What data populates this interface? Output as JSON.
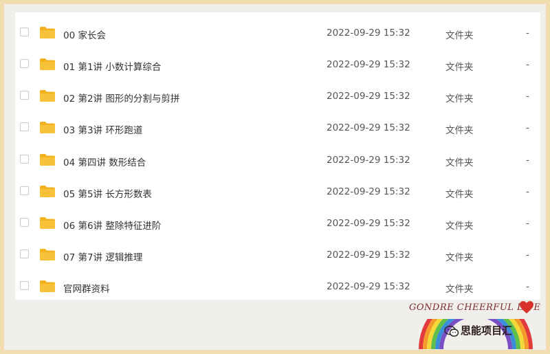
{
  "files": [
    {
      "name": "00 家长会",
      "date": "2022-09-29 15:32",
      "type": "文件夹",
      "size": "-"
    },
    {
      "name": "01 第1讲 小数计算综合",
      "date": "2022-09-29 15:32",
      "type": "文件夹",
      "size": "-"
    },
    {
      "name": "02 第2讲 图形的分割与剪拼",
      "date": "2022-09-29 15:32",
      "type": "文件夹",
      "size": "-"
    },
    {
      "name": "03 第3讲 环形跑道",
      "date": "2022-09-29 15:32",
      "type": "文件夹",
      "size": "-"
    },
    {
      "name": "04 第四讲 数形结合",
      "date": "2022-09-29 15:32",
      "type": "文件夹",
      "size": "-"
    },
    {
      "name": "05 第5讲 长方形数表",
      "date": "2022-09-29 15:32",
      "type": "文件夹",
      "size": "-"
    },
    {
      "name": "06 第6讲 整除特征进阶",
      "date": "2022-09-29 15:32",
      "type": "文件夹",
      "size": "-"
    },
    {
      "name": "07 第7讲 逻辑推理",
      "date": "2022-09-29 15:32",
      "type": "文件夹",
      "size": "-"
    },
    {
      "name": "官网群资料",
      "date": "2022-09-29 15:32",
      "type": "文件夹",
      "size": "-"
    }
  ],
  "watermark": {
    "brand": "GONDRE CHEERFUL LIFE",
    "account": "思能项目汇"
  },
  "icons": {
    "folder": "folder-icon",
    "checkbox": "checkbox-icon",
    "heart": "heart-icon",
    "wechat": "wechat-icon"
  },
  "colors": {
    "folder": "#f7c23a",
    "folder_tab": "#f2b21e",
    "background": "#f1efec",
    "border": "#f1ddb0"
  }
}
